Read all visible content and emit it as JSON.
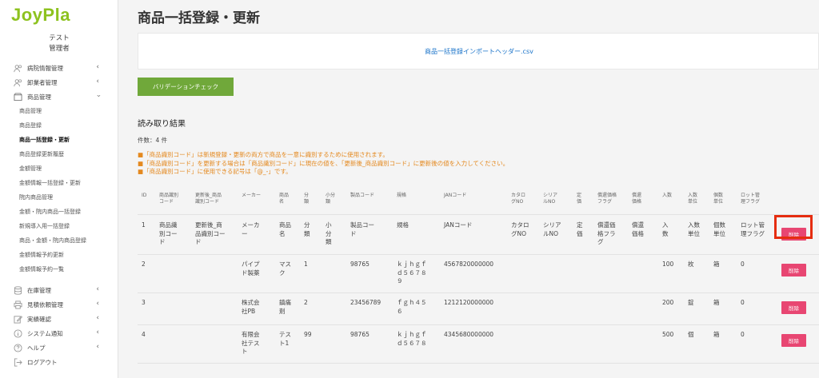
{
  "app": {
    "logo": "JoyPla"
  },
  "user": {
    "name": "テスト",
    "role": "管理者"
  },
  "sidebar": {
    "items": [
      {
        "label": "病院情報管理",
        "icon": "people-icon"
      },
      {
        "label": "卸業者管理",
        "icon": "people-icon"
      },
      {
        "label": "商品管理",
        "icon": "box-icon"
      }
    ],
    "product_sub": [
      "商品管理",
      "商品登録",
      "商品一括登録・更新",
      "商品登録更新履歴",
      "金額管理",
      "金額情報一括登録・更新",
      "院内商品管理",
      "金額・院内商品一括登録",
      "新規導入用一括登録",
      "商品・金額・院内商品登録",
      "金額情報予約更新",
      "金額情報予約一覧"
    ],
    "bottom_items": [
      {
        "label": "在庫管理",
        "icon": "database-icon"
      },
      {
        "label": "見積依頼管理",
        "icon": "printer-icon"
      },
      {
        "label": "実績確認",
        "icon": "edit-icon"
      },
      {
        "label": "システム通知",
        "icon": "info-icon"
      },
      {
        "label": "ヘルプ",
        "icon": "help-icon"
      },
      {
        "label": "ログアウト",
        "icon": "logout-icon"
      }
    ]
  },
  "main": {
    "title": "商品一括登録・更新",
    "file_link": "商品一括登録インポートヘッダー.csv",
    "validate_button": "バリデーションチェック",
    "results_title": "読み取り結果",
    "count": "件数：4 件",
    "notes": [
      "■「商品識別コード」は新規登録・更新の両方で商品を一意に識別するために使用されます。",
      "■「商品識別コード」を更新する場合は「商品識別コード」に現在の値を、「更新後_商品識別コード」に更新後の値を入力してください。",
      "■「商品識別コード」に使用できる記号は「@_-」です。"
    ]
  },
  "table": {
    "headers": [
      "ID",
      "商品識別\nコード",
      "更新後_商品\n識別コード",
      "メーカー",
      "商品\n名",
      "分\n類",
      "小分\n類",
      "製品コード",
      "規格",
      "JANコード",
      "カタロ\nグNO",
      "シリア\nルNO",
      "定\n価",
      "償還価格\nフラグ",
      "償還\n価格",
      "入数",
      "入数\n単位",
      "個数\n単位",
      "ロット管\n理フラグ"
    ],
    "rows": [
      [
        "1",
        "商品識\n別コー\nド",
        "更新後_商\n品識別コー\nド",
        "メーカ\nー",
        "商品\n名",
        "分\n類",
        "小\n分\n類",
        "製品コー\nド",
        "規格",
        "JANコード",
        "カタロ\nグNO",
        "シリア\nルNO",
        "定\n価",
        "償還価\n格フラ\nグ",
        "償還\n価格",
        "入\n数",
        "入数\n単位",
        "個数\n単位",
        "ロット管\n理フラグ"
      ],
      [
        "2",
        "",
        "",
        "パイプ\nド製薬",
        "マス\nク",
        "1",
        "",
        "98765",
        "ｋｊｈｇｆ\nｄ５６７８\n９",
        "4567820000000",
        "",
        "",
        "",
        "",
        "",
        "100",
        "枚",
        "箱",
        "0"
      ],
      [
        "3",
        "",
        "",
        "株式会\n社PB",
        "鎮痛\n剤",
        "2",
        "",
        "23456789",
        "ｆｇｈ４５\n６",
        "1212120000000",
        "",
        "",
        "",
        "",
        "",
        "200",
        "錠",
        "箱",
        "0"
      ],
      [
        "4",
        "",
        "",
        "有限会\n社テス\nト",
        "テス\nト1",
        "99",
        "",
        "98765",
        "ｋｊｈｇｆ\nｄ５６７８",
        "4345680000000",
        "",
        "",
        "",
        "",
        "",
        "500",
        "個",
        "箱",
        "0"
      ]
    ],
    "delete_label": "削除"
  }
}
